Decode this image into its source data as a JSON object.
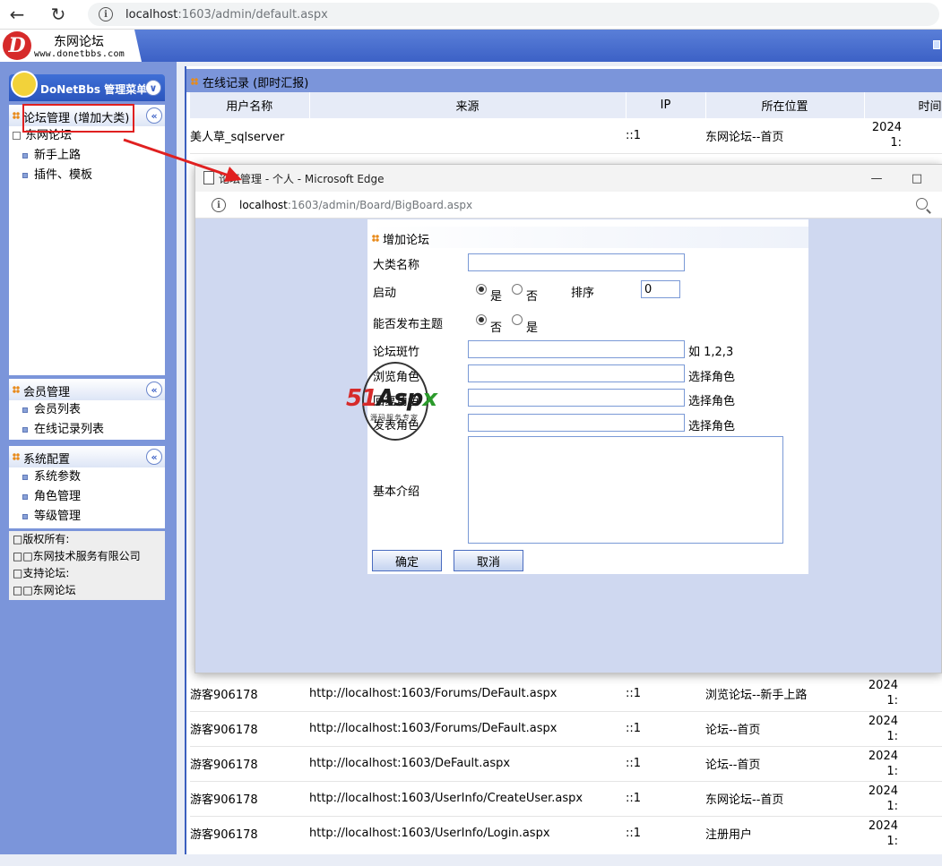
{
  "browser": {
    "url_host": "localhost",
    "url_rest": ":1603/admin/default.aspx"
  },
  "site": {
    "logo_title": "东网论坛",
    "logo_url": "www.donetbbs.com",
    "logo_letter": "D"
  },
  "left_menu": {
    "title": "DoNetBbs 管理菜单",
    "sections": {
      "forum": {
        "label": "论坛管理 (增加大类)",
        "tree_root": "东网论坛",
        "items": [
          "新手上路",
          "插件、模板"
        ]
      },
      "member": {
        "label": "会员管理",
        "items": [
          "会员列表",
          "在线记录列表"
        ]
      },
      "system": {
        "label": "系统配置",
        "items": [
          "系统参数",
          "角色管理",
          "等级管理"
        ]
      }
    },
    "copyright": [
      "□版权所有:",
      "□□东网技术服务有限公司",
      "□支持论坛:",
      "□□东网论坛"
    ]
  },
  "main": {
    "title": "在线记录 (即时汇报)",
    "columns": [
      "用户名称",
      "来源",
      "IP",
      "所在位置",
      "时间"
    ],
    "rows": [
      {
        "user": "美人草_sqlserver",
        "source": "",
        "ip": "::1",
        "location": "东网论坛--首页",
        "time1": "2024",
        "time2": "1:"
      },
      {
        "user": "游客906178",
        "source": "http://localhost:1603/Forums/DeFault.aspx",
        "ip": "::1",
        "location": "浏览论坛--新手上路",
        "time1": "2024",
        "time2": "1:"
      },
      {
        "user": "游客906178",
        "source": "http://localhost:1603/Forums/DeFault.aspx",
        "ip": "::1",
        "location": "论坛--首页",
        "time1": "2024",
        "time2": "1:"
      },
      {
        "user": "游客906178",
        "source": "http://localhost:1603/DeFault.aspx",
        "ip": "::1",
        "location": "论坛--首页",
        "time1": "2024",
        "time2": "1:"
      },
      {
        "user": "游客906178",
        "source": "http://localhost:1603/UserInfo/CreateUser.aspx",
        "ip": "::1",
        "location": "东网论坛--首页",
        "time1": "2024",
        "time2": "1:"
      },
      {
        "user": "游客906178",
        "source": "http://localhost:1603/UserInfo/Login.aspx",
        "ip": "::1",
        "location": "注册用户",
        "time1": "2024",
        "time2": "1:"
      }
    ]
  },
  "popup": {
    "title": "论坛管理 - 个人 - Microsoft Edge",
    "url_host": "localhost",
    "url_rest": ":1603/admin/Board/BigBoard.aspx",
    "form": {
      "heading": "增加论坛",
      "category_name_label": "大类名称",
      "category_name_value": "",
      "enable_label": "启动",
      "enable_yes": "是",
      "enable_no": "否",
      "sort_label": "排序",
      "sort_value": "0",
      "can_post_label": "能否发布主题",
      "can_post_no": "否",
      "can_post_yes": "是",
      "moderators_label": "论坛斑竹",
      "moderators_value": "",
      "moderators_hint": "如 1,2,3",
      "browse_roles_label": "浏览角色",
      "browse_roles_value": "",
      "browse_roles_hint": "选择角色",
      "reply_roles_label": "回复角色",
      "reply_roles_value": "",
      "reply_roles_hint": "选择角色",
      "post_roles_label": "发表角色",
      "post_roles_value": "",
      "post_roles_hint": "选择角色",
      "intro_label": "基本介绍",
      "confirm_button": "确定",
      "cancel_button": "取消"
    },
    "watermark_main": "51Aspx",
    "watermark_sub": "源码服务专家"
  },
  "colors": {
    "accent_blue": "#3c61c6",
    "annotation_red": "#e02020",
    "bullet_orange": "#e88a1a"
  }
}
